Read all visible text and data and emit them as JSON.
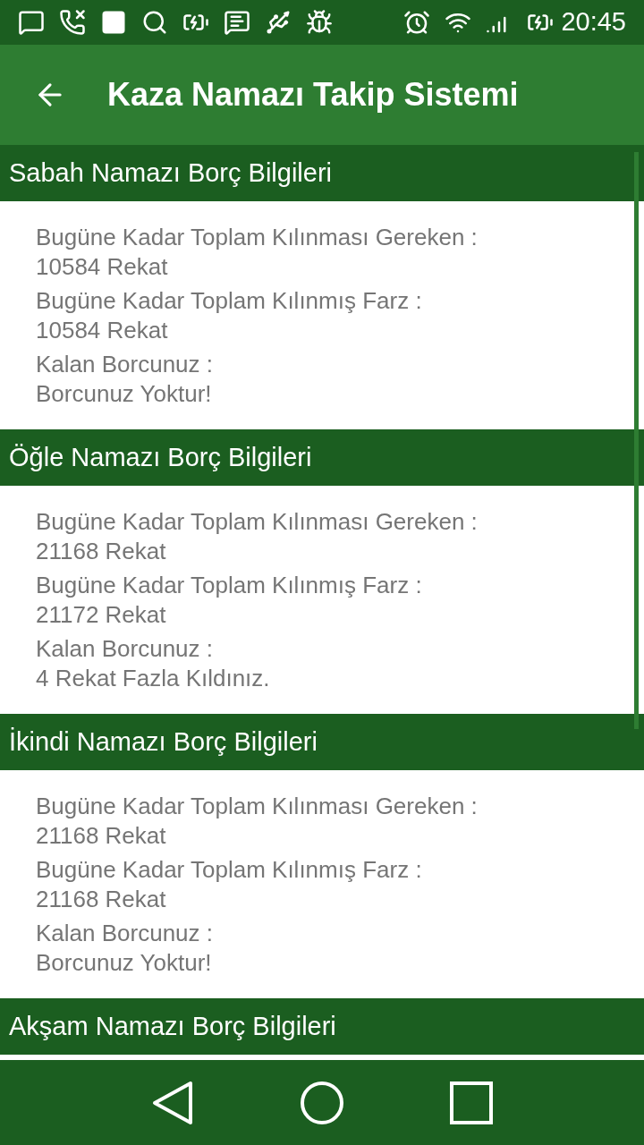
{
  "status_bar": {
    "time": "20:45"
  },
  "app_bar": {
    "title": "Kaza Namazı Takip Sistemi"
  },
  "sections": [
    {
      "title": "Sabah Namazı Borç Bilgileri",
      "rows": [
        {
          "label": "Bugüne Kadar Toplam Kılınması Gereken :",
          "value": "10584 Rekat"
        },
        {
          "label": "Bugüne Kadar Toplam Kılınmış Farz :",
          "value": "10584 Rekat"
        },
        {
          "label": "Kalan Borcunuz :",
          "value": "Borcunuz Yoktur!"
        }
      ]
    },
    {
      "title": "Öğle Namazı Borç Bilgileri",
      "rows": [
        {
          "label": "Bugüne Kadar Toplam Kılınması Gereken :",
          "value": "21168 Rekat"
        },
        {
          "label": "Bugüne Kadar Toplam Kılınmış Farz :",
          "value": "21172 Rekat"
        },
        {
          "label": "Kalan Borcunuz :",
          "value": "4 Rekat Fazla Kıldınız."
        }
      ]
    },
    {
      "title": "İkindi Namazı Borç Bilgileri",
      "rows": [
        {
          "label": "Bugüne Kadar Toplam Kılınması Gereken :",
          "value": "21168 Rekat"
        },
        {
          "label": "Bugüne Kadar Toplam Kılınmış Farz :",
          "value": "21168 Rekat"
        },
        {
          "label": "Kalan Borcunuz :",
          "value": "Borcunuz Yoktur!"
        }
      ]
    },
    {
      "title": "Akşam Namazı Borç Bilgileri"
    }
  ]
}
